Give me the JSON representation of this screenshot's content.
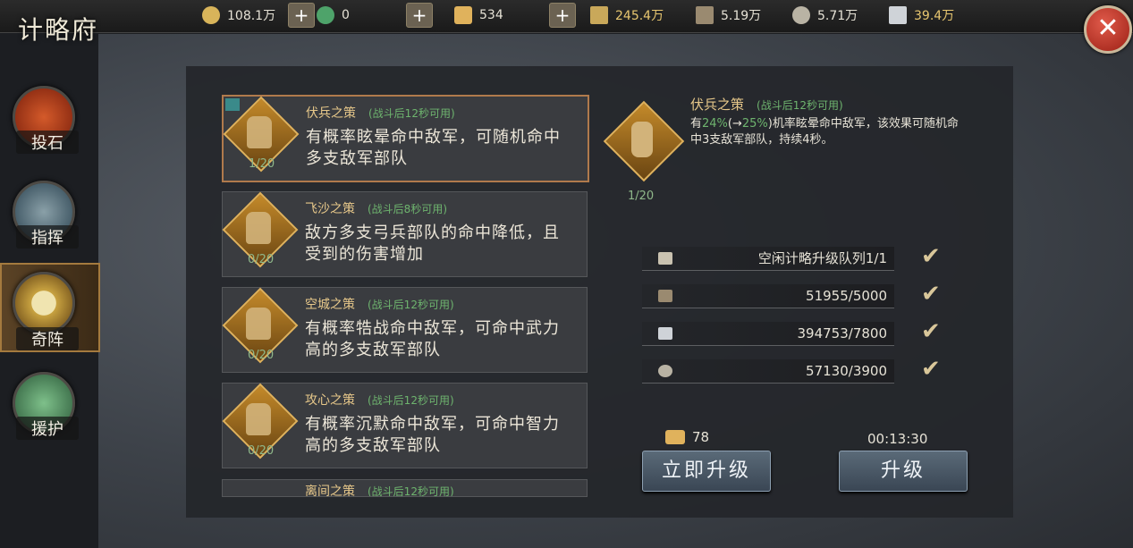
{
  "header": {
    "title": "计略府",
    "resources": [
      {
        "icon": "coin-icon",
        "value": "108.1万"
      },
      {
        "icon": "jade-icon",
        "value": "0"
      },
      {
        "icon": "gold-ingot-icon",
        "value": "534"
      },
      {
        "icon": "grain-icon",
        "value": "245.4万"
      },
      {
        "icon": "wood-icon",
        "value": "5.19万"
      },
      {
        "icon": "stone-icon",
        "value": "5.71万"
      },
      {
        "icon": "iron-icon",
        "value": "39.4万"
      }
    ],
    "plus_label": "+",
    "close_label": "✕"
  },
  "nav": [
    {
      "label": "投石",
      "active": false
    },
    {
      "label": "指挥",
      "active": false
    },
    {
      "label": "奇阵",
      "active": true
    },
    {
      "label": "援护",
      "active": false
    }
  ],
  "strategies": [
    {
      "name": "伏兵之策",
      "cooldown": "(战斗后12秒可用)",
      "desc": "有概率眩晕命中敌军，可随机命中多支敌军部队",
      "level": "1/20",
      "selected": true
    },
    {
      "name": "飞沙之策",
      "cooldown": "(战斗后8秒可用)",
      "desc": "敌方多支弓兵部队的命中降低，且受到的伤害增加",
      "level": "0/20",
      "selected": false
    },
    {
      "name": "空城之策",
      "cooldown": "(战斗后12秒可用)",
      "desc": "有概率牿战命中敌军，可命中武力高的多支敌军部队",
      "level": "0/20",
      "selected": false
    },
    {
      "name": "攻心之策",
      "cooldown": "(战斗后12秒可用)",
      "desc": "有概率沉默命中敌军，可命中智力高的多支敌军部队",
      "level": "0/20",
      "selected": false
    },
    {
      "name": "离间之策",
      "cooldown": "(战斗后12秒可用)",
      "desc": "",
      "level": "",
      "selected": false
    }
  ],
  "detail": {
    "name": "伏兵之策",
    "cooldown": "(战斗后12秒可用)",
    "desc_pre": "有",
    "desc_pct": "24%",
    "desc_mid": "(→",
    "desc_pct2": "25%",
    "desc_post": ")机率眩晕命中敌军，该效果可随机命中3支敌军部队，持续4秒。",
    "level": "1/20"
  },
  "requirements": [
    {
      "icon": "hammer-icon",
      "value": "空闲计略升级队列1/1"
    },
    {
      "icon": "wood-icon",
      "value": "51955/5000"
    },
    {
      "icon": "iron-icon",
      "value": "394753/7800"
    },
    {
      "icon": "stone-icon",
      "value": "57130/3900"
    }
  ],
  "check_glyph": "✔",
  "cost": {
    "icon": "gold-ingot-icon",
    "value": "78"
  },
  "timer": "00:13:30",
  "buttons": {
    "instant": "立即升级",
    "upgrade": "升级"
  },
  "colors": {
    "gold": "#e7c88a",
    "green": "#6eb46e",
    "close": "#c0392b"
  }
}
